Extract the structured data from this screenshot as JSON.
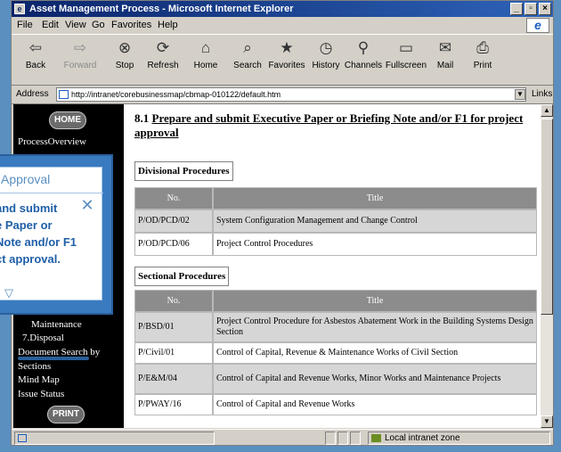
{
  "window": {
    "title": "Asset Management Process - Microsoft Internet Explorer"
  },
  "menubar": [
    "File",
    "Edit",
    "View",
    "Go",
    "Favorites",
    "Help"
  ],
  "toolbar": [
    {
      "label": "Back",
      "icon": "back-arrow-icon",
      "glyph": "⇦"
    },
    {
      "label": "Forward",
      "icon": "forward-arrow-icon",
      "glyph": "⇨"
    },
    {
      "label": "Stop",
      "icon": "stop-icon",
      "glyph": "⊗"
    },
    {
      "label": "Refresh",
      "icon": "refresh-icon",
      "glyph": "⟳"
    },
    {
      "label": "Home",
      "icon": "home-icon",
      "glyph": "⌂"
    },
    {
      "label": "Search",
      "icon": "search-icon",
      "glyph": "⌕"
    },
    {
      "label": "Favorites",
      "icon": "favorites-icon",
      "glyph": "★"
    },
    {
      "label": "History",
      "icon": "history-icon",
      "glyph": "◷"
    },
    {
      "label": "Channels",
      "icon": "channels-icon",
      "glyph": "⚲"
    },
    {
      "label": "Fullscreen",
      "icon": "fullscreen-icon",
      "glyph": "▭"
    },
    {
      "label": "Mail",
      "icon": "mail-icon",
      "glyph": "✉"
    },
    {
      "label": "Print",
      "icon": "print-icon",
      "glyph": "⎙"
    }
  ],
  "address": {
    "label": "Address",
    "url": "http://intranet/corebusinessmap/cbmap-010122/default.htm",
    "links_label": "Links"
  },
  "sidebar": {
    "home_label": "HOME",
    "print_label": "PRINT",
    "items": [
      "ProcessOverview",
      "Maintenance",
      "7.Disposal",
      "Document Search by",
      "Sections",
      "Mind Map",
      "Issue Status"
    ]
  },
  "main": {
    "heading_num": "8.1",
    "heading_text": "Prepare and submit Executive Paper or Briefing Note and/or F1 for project approval",
    "divisional": {
      "label": "Divisional Procedures",
      "columns": [
        "No.",
        "Title"
      ],
      "rows": [
        [
          "P/OD/PCD/02",
          "System Configuration Management and Change Control"
        ],
        [
          "P/OD/PCD/06",
          "Project Control Procedures"
        ]
      ]
    },
    "sectional": {
      "label": "Sectional Procedures",
      "columns": [
        "No.",
        "Title"
      ],
      "rows": [
        [
          "P/BSD/01",
          "Project Control Procedure for Asbestos Abatement Work in the Building Systems Design Section"
        ],
        [
          "P/Civil/01",
          "Control of Capital, Revenue & Maintenance Works of Civil Section"
        ],
        [
          "P/E&M/04",
          "Control of Capital and Revenue Works, Minor Works and Maintenance Projects"
        ],
        [
          "P/PWAY/16",
          "Control of Capital and Revenue Works"
        ]
      ]
    }
  },
  "callout": {
    "title": "Approval",
    "body": [
      "and submit",
      "e Paper or",
      "Note and/or F1",
      "ct approval."
    ]
  },
  "statusbar": {
    "zone": "Local intranet zone"
  },
  "colors": {
    "titlebar": "#0a246a",
    "desktop": "#5a8fc0",
    "callout_border": "#3a7bc0",
    "table_header": "#8c8c8c",
    "row_shade": "#d6d6d6"
  }
}
